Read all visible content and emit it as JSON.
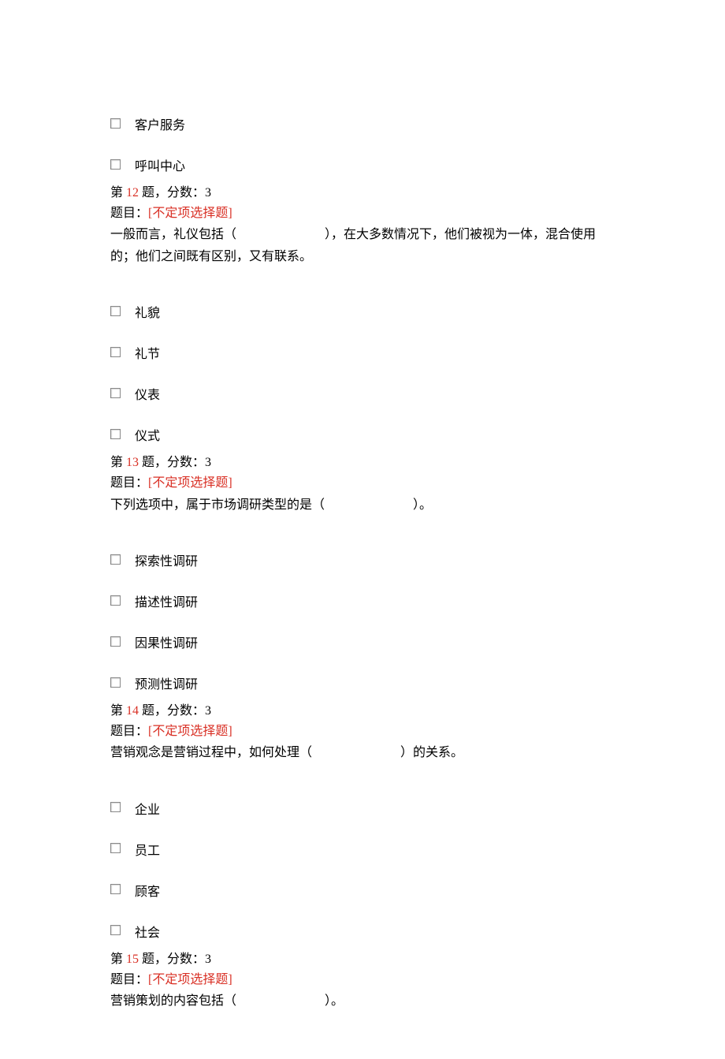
{
  "orphan_options": [
    {
      "label": "客户服务"
    },
    {
      "label": "呼叫中心"
    }
  ],
  "questions": [
    {
      "num": "12",
      "prefix": "第 ",
      "mid": " 题，分数：",
      "score": "3",
      "type_prefix": "题目：",
      "type": "[不定项选择题]",
      "stem_a": "一般而言，礼仪包括（　　　　　　　），在大多数情况下，他们被视为一体，混合使用",
      "stem_b": "的；他们之间既有区别，又有联系。",
      "options": [
        {
          "label": "礼貌"
        },
        {
          "label": "礼节"
        },
        {
          "label": "仪表"
        },
        {
          "label": "仪式"
        }
      ]
    },
    {
      "num": "13",
      "prefix": "第 ",
      "mid": " 题，分数：",
      "score": "3",
      "type_prefix": "题目：",
      "type": "[不定项选择题]",
      "stem_a": "下列选项中，属于市场调研类型的是（　　　　　　　）。",
      "stem_b": "",
      "options": [
        {
          "label": "探索性调研"
        },
        {
          "label": "描述性调研"
        },
        {
          "label": "因果性调研"
        },
        {
          "label": "预测性调研"
        }
      ]
    },
    {
      "num": "14",
      "prefix": "第 ",
      "mid": " 题，分数：",
      "score": "3",
      "type_prefix": "题目：",
      "type": "[不定项选择题]",
      "stem_a": "营销观念是营销过程中，如何处理（　　　　　　　）的关系。",
      "stem_b": "",
      "options": [
        {
          "label": "企业"
        },
        {
          "label": "员工"
        },
        {
          "label": "顾客"
        },
        {
          "label": "社会"
        }
      ]
    },
    {
      "num": "15",
      "prefix": "第 ",
      "mid": " 题，分数：",
      "score": "3",
      "type_prefix": "题目：",
      "type": "[不定项选择题]",
      "stem_a": "营销策划的内容包括（　　　　　　　）。",
      "stem_b": "",
      "options": []
    }
  ]
}
